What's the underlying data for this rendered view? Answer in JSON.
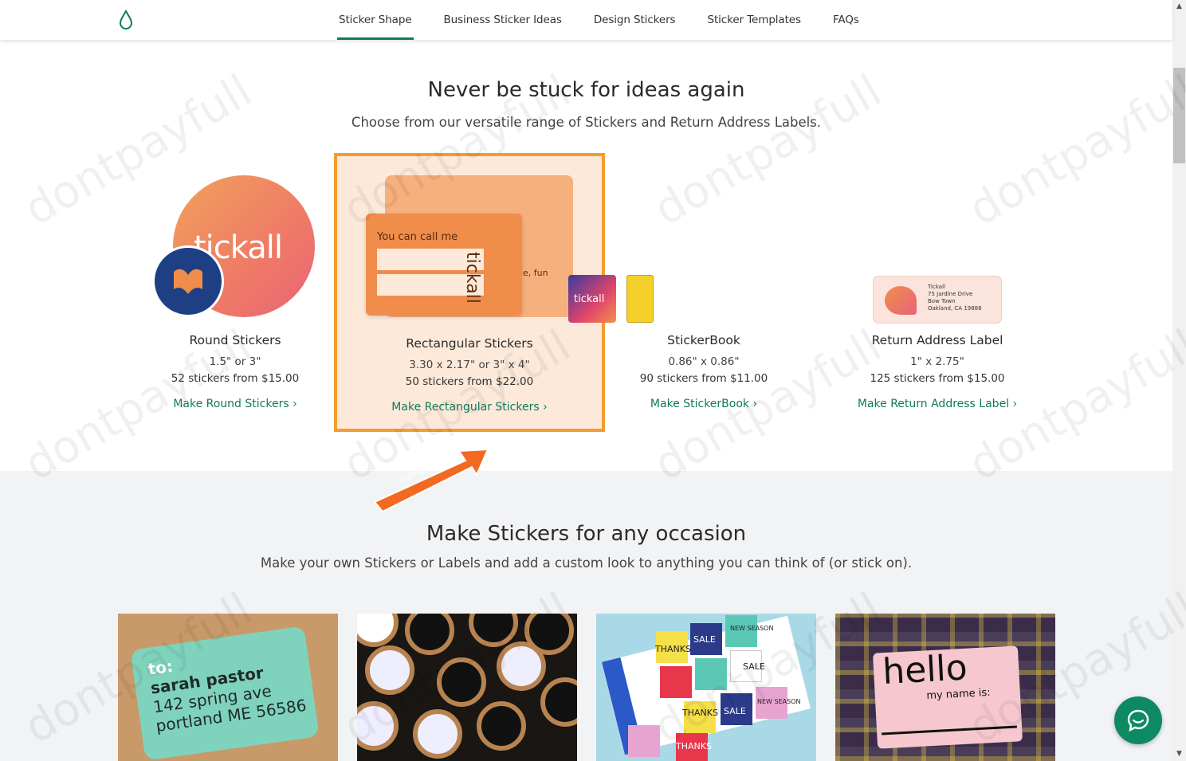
{
  "nav": {
    "items": [
      "Sticker Shape",
      "Business Sticker Ideas",
      "Design Stickers",
      "Sticker Templates",
      "FAQs"
    ],
    "active": "Sticker Shape"
  },
  "ideas": {
    "title": "Never be stuck for ideas again",
    "subtitle": "Choose from our versatile range of Stickers and Return Address Labels.",
    "products": [
      {
        "name": "Round Stickers",
        "size": "1.5\" or 3\"",
        "price": "52 stickers from $15.00",
        "cta": "Make Round Stickers ›",
        "art_text": "tickall"
      },
      {
        "name": "Rectangular Stickers",
        "size": "3.30 x 2.17\" or 3\" x 4\"",
        "price": "50 stickers from $22.00",
        "cta": "Make Rectangular Stickers ›",
        "art_label": "You can call me",
        "art_vertical": "tickall",
        "art_back": "ne, fun"
      },
      {
        "name": "StickerBook",
        "size": "0.86\" x 0.86\"",
        "price": "90 stickers from $11.00",
        "cta": "Make StickerBook ›",
        "art_text": "tickall"
      },
      {
        "name": "Return Address Label",
        "size": "1\" x 2.75\"",
        "price": "125 stickers from $15.00",
        "cta": "Make Return Address Label ›",
        "art_lines": [
          "Tickall",
          "75 Jardine Drive",
          "Bow Town",
          "Oakland, CA 19888"
        ]
      }
    ]
  },
  "badge": {
    "text": "dontpayfull"
  },
  "occasion": {
    "title": "Make Stickers for any occasion",
    "subtitle": "Make your own Stickers or Labels and add a custom look to anything you can think of (or stick on).",
    "tile1": {
      "line1": "to:",
      "line2": "sarah pastor",
      "line3": "142 spring ave",
      "line4": "portland ME 56586"
    },
    "tile3": {
      "words": [
        "THANKS",
        "SALE",
        "NEW SEASON",
        "SALE",
        "THANKS",
        "SALE",
        "NEW SEASON",
        "THANKS"
      ]
    },
    "tile4": {
      "hello": "hello",
      "name": "my name is:"
    }
  },
  "watermark": "dontpayfull",
  "colors": {
    "accent": "#0e7a5e",
    "highlight_border": "#f39c30",
    "highlight_bg": "#fde9d9"
  }
}
